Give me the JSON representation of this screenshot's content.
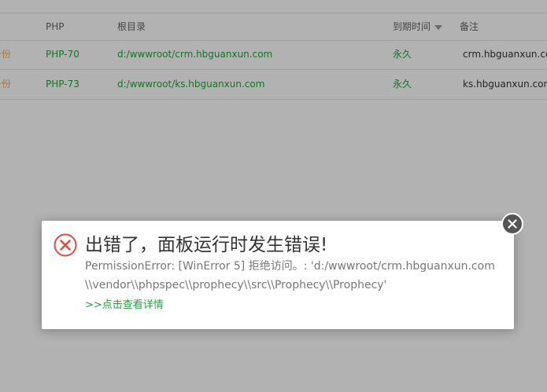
{
  "table": {
    "headers": {
      "php": "PHP",
      "root": "根目录",
      "expire": "到期时间",
      "note": "备注"
    },
    "rows": [
      {
        "backup": "备份",
        "php": "PHP-70",
        "root": "d:/wwwroot/crm.hbguanxun.com",
        "expire": "永久",
        "note": "crm.hbguanxun.com"
      },
      {
        "backup": "备份",
        "php": "PHP-73",
        "root": "d:/wwwroot/ks.hbguanxun.com",
        "expire": "永久",
        "note": "ks.hbguanxun.com"
      }
    ]
  },
  "dialog": {
    "title": "出错了，面板运行时发生错误!",
    "message": "PermissionError: [WinError 5] 拒绝访问。: 'd:/wwwroot/crm.hbguanxun.com\\\\vendor\\\\phpspec\\\\prophecy\\\\src\\\\Prophecy\\\\Prophecy'",
    "detail_link": ">>点击查看详情"
  },
  "icons": {
    "error": "error-circle-x-icon",
    "close": "close-icon",
    "sort": "caret-down-icon"
  },
  "colors": {
    "accent_green": "#20a53a",
    "backup_orange": "#f0ad4e",
    "error_red": "#e8483f"
  }
}
